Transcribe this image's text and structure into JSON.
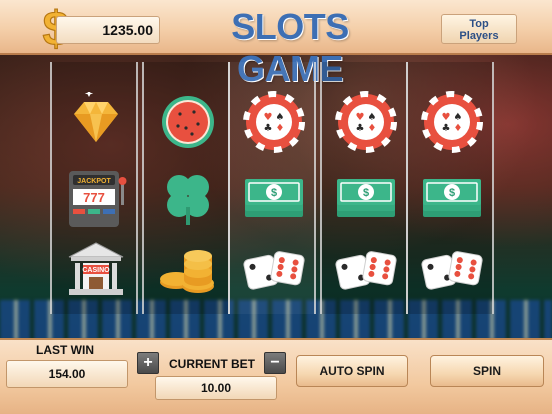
{
  "header": {
    "balance": "1235.00",
    "title": "SLOTS GAME",
    "top_players_line1": "Top",
    "top_players_line2": "Players"
  },
  "reels": [
    [
      "diamond-icon",
      "jackpot-slot-machine-icon",
      "casino-building-icon"
    ],
    [
      "watermelon-icon",
      "clover-icon",
      "gold-coins-icon"
    ],
    [
      "poker-chip-icon",
      "cash-stack-icon",
      "dice-icon"
    ],
    [
      "poker-chip-icon",
      "cash-stack-icon",
      "dice-icon"
    ],
    [
      "poker-chip-icon",
      "cash-stack-icon",
      "dice-icon"
    ]
  ],
  "symbol_text": {
    "jackpot": "JACKPOT",
    "sevens": "777",
    "casino": "CASINO"
  },
  "controls": {
    "last_win_label": "LAST WIN",
    "last_win_value": "154.00",
    "plus": "+",
    "minus": "−",
    "current_bet_label": "CURRENT BET",
    "current_bet_value": "10.00",
    "auto_spin": "AUTO SPIN",
    "spin": "SPIN"
  },
  "colors": {
    "title": "#3d6fb4",
    "chip_red": "#e8503f",
    "cash_green": "#2e9e75",
    "clover_green": "#3cb68a",
    "gold": "#f2b233"
  }
}
